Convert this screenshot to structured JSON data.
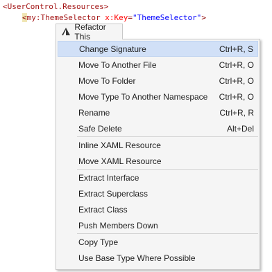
{
  "code": {
    "line1": "<UserControl.Resources>",
    "line2_open": "<",
    "line2_tag": "my:ThemeSelector",
    "line2_attr": " x:Key",
    "line2_eq": "=",
    "line2_value": "\"ThemeSelector\"",
    "line2_close": ">"
  },
  "menu": {
    "title": "Refactor This",
    "groups": [
      [
        {
          "label": "Change Signature",
          "shortcut": "Ctrl+R, S",
          "highlighted": true
        },
        {
          "label": "Move To Another File",
          "shortcut": "Ctrl+R, O"
        },
        {
          "label": "Move To Folder",
          "shortcut": "Ctrl+R, O"
        },
        {
          "label": "Move Type To Another Namespace",
          "shortcut": "Ctrl+R, O"
        },
        {
          "label": "Rename",
          "shortcut": "Ctrl+R, R"
        },
        {
          "label": "Safe Delete",
          "shortcut": "Alt+Del"
        }
      ],
      [
        {
          "label": "Inline XAML Resource",
          "shortcut": ""
        },
        {
          "label": "Move XAML Resource",
          "shortcut": ""
        }
      ],
      [
        {
          "label": "Extract Interface",
          "shortcut": ""
        },
        {
          "label": "Extract Superclass",
          "shortcut": ""
        },
        {
          "label": "Extract Class",
          "shortcut": ""
        },
        {
          "label": "Push Members Down",
          "shortcut": ""
        }
      ],
      [
        {
          "label": "Copy Type",
          "shortcut": ""
        },
        {
          "label": "Use Base Type Where Possible",
          "shortcut": ""
        }
      ]
    ]
  },
  "colors": {
    "highlight": "#d1e0f7",
    "menu_bg": "#f5f5f5",
    "xml_tag": "#a31515",
    "xml_value": "#0000ff",
    "xml_attr": "#ff0000"
  },
  "icons": {
    "header": "refactor-icon"
  }
}
